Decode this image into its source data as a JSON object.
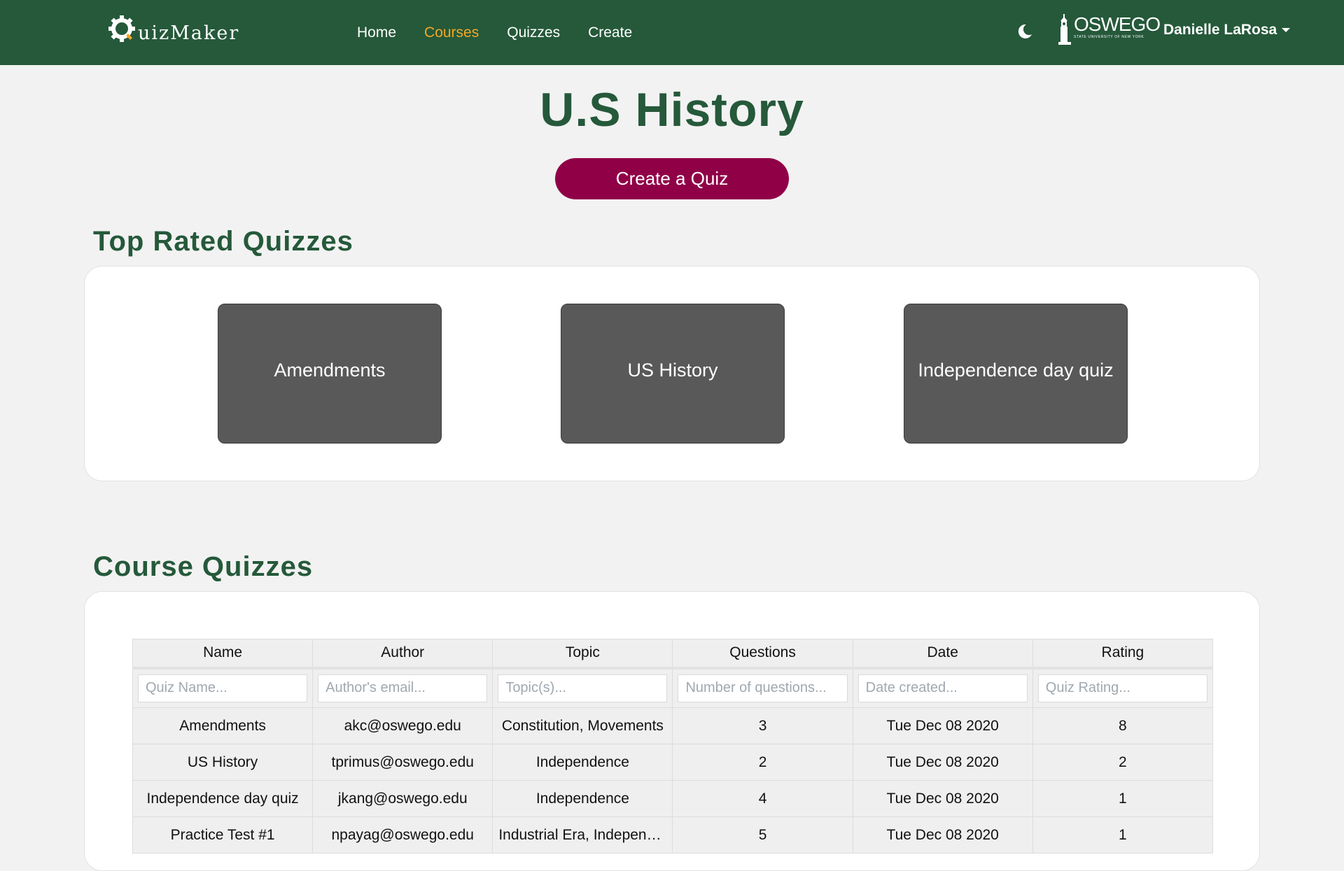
{
  "navbar": {
    "logo_text": "uizMaker",
    "links": [
      "Home",
      "Courses",
      "Quizzes",
      "Create"
    ],
    "active_link": "Courses",
    "university": "OSWEGO",
    "university_sub": "STATE UNIVERSITY OF NEW YORK",
    "user_name": "Danielle LaRosa",
    "colors": {
      "bar": "#25593a",
      "active": "#f5a623"
    }
  },
  "page": {
    "title": "U.S History",
    "create_button": "Create a Quiz",
    "accent": "#900047"
  },
  "top_rated": {
    "title": "Top Rated Quizzes",
    "cards": [
      "Amendments",
      "US History",
      "Independence day quiz"
    ]
  },
  "course_quizzes": {
    "title": "Course Quizzes",
    "columns": [
      "Name",
      "Author",
      "Topic",
      "Questions",
      "Date",
      "Rating"
    ],
    "filters": [
      "Quiz Name...",
      "Author's email...",
      "Topic(s)...",
      "Number of questions...",
      "Date created...",
      "Quiz Rating..."
    ],
    "rows": [
      [
        "Amendments",
        "akc@oswego.edu",
        "Constitution, Movements",
        "3",
        "Tue Dec 08 2020",
        "8"
      ],
      [
        "US History",
        "tprimus@oswego.edu",
        "Independence",
        "2",
        "Tue Dec 08 2020",
        "2"
      ],
      [
        "Independence day quiz",
        "jkang@oswego.edu",
        "Independence",
        "4",
        "Tue Dec 08 2020",
        "1"
      ],
      [
        "Practice Test #1",
        "npayag@oswego.edu",
        "Industrial Era, Independ...",
        "5",
        "Tue Dec 08 2020",
        "1"
      ]
    ]
  }
}
